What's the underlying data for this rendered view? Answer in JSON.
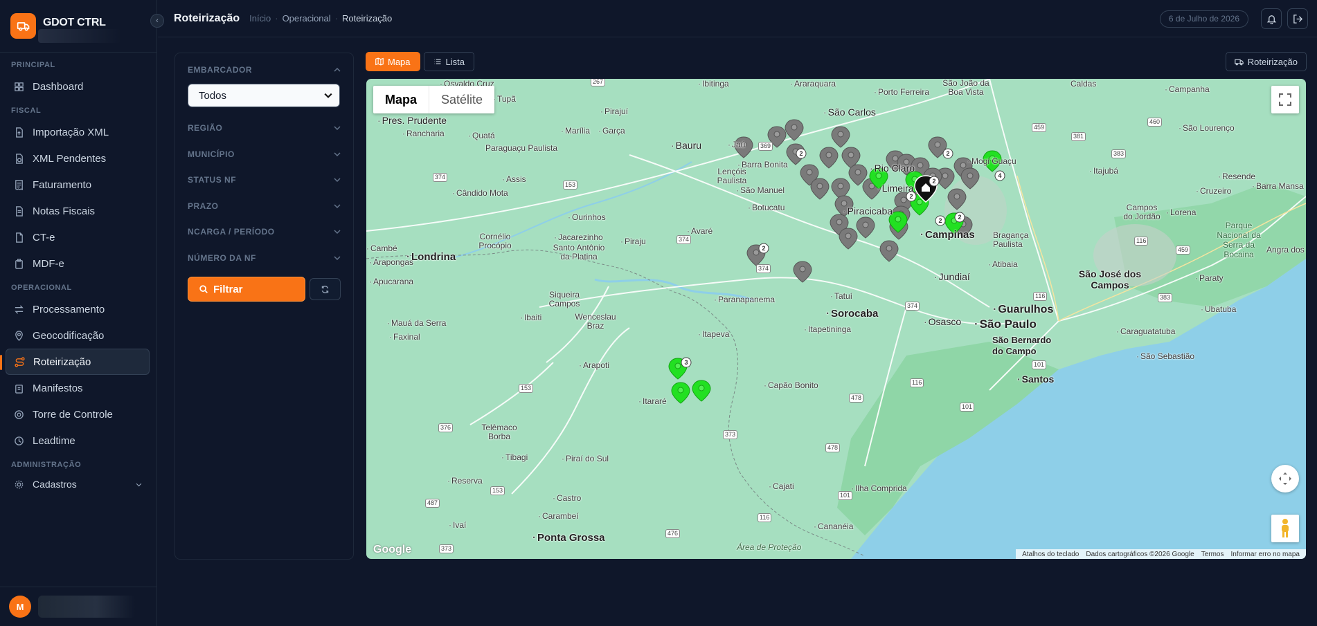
{
  "app": {
    "name": "GDOT CTRL"
  },
  "sidebar": {
    "sections": [
      {
        "label": "PRINCIPAL",
        "items": [
          {
            "label": "Dashboard"
          }
        ]
      },
      {
        "label": "FISCAL",
        "items": [
          {
            "label": "Importação XML"
          },
          {
            "label": "XML Pendentes"
          },
          {
            "label": "Faturamento"
          },
          {
            "label": "Notas Fiscais"
          },
          {
            "label": "CT-e"
          },
          {
            "label": "MDF-e"
          }
        ]
      },
      {
        "label": "OPERACIONAL",
        "items": [
          {
            "label": "Processamento"
          },
          {
            "label": "Geocodificação"
          },
          {
            "label": "Roteirização"
          },
          {
            "label": "Manifestos"
          },
          {
            "label": "Torre de Controle"
          },
          {
            "label": "Leadtime"
          }
        ]
      },
      {
        "label": "ADMINISTRAÇÃO",
        "items": [
          {
            "label": "Cadastros"
          }
        ]
      }
    ],
    "active_item": "Roteirização",
    "user_initial": "M"
  },
  "header": {
    "title": "Roteirização",
    "breadcrumb": [
      "Início",
      "Operacional",
      "Roteirização"
    ],
    "date": "6 de Julho de 2026"
  },
  "filters": {
    "embarcador_label": "EMBARCADOR",
    "embarcador_value": "Todos",
    "items": [
      "REGIÃO",
      "MUNICÍPIO",
      "STATUS NF",
      "PRAZO",
      "NCARGA / PERÍODO",
      "NÚMERO DA NF"
    ],
    "filter_button": "Filtrar"
  },
  "view_tabs": [
    "Mapa",
    "Lista"
  ],
  "active_view": "Mapa",
  "route_button": "Roteirização",
  "map": {
    "type_buttons": [
      "Mapa",
      "Satélite"
    ],
    "active_type": "Mapa",
    "logo": "Google",
    "attribution": [
      "Atalhos do teclado",
      "Dados cartográficos ©2026 Google",
      "Termos",
      "Informar erro no mapa"
    ],
    "cities": [
      "Osvaldo Cruz",
      "Tupã",
      "Pres. Prudente",
      "Rancharia",
      "Quatá",
      "Marília",
      "Garça",
      "Paraguaçu Paulista",
      "Assis",
      "Cândido Mota",
      "Bauru",
      "Jaú",
      "Barra Bonita",
      "Lençóis Paulista",
      "São Manuel",
      "Botucatu",
      "Ourinhos",
      "Avaré",
      "Piraju",
      "Jacarezinho",
      "Cornélio Procópio",
      "Santo Antônio da Platina",
      "Londrina",
      "Cambé",
      "Arapongas",
      "Apucarana",
      "Siqueira Campos",
      "Ibaiti",
      "Wenceslau Braz",
      "Itapeva",
      "Mauá da Serra",
      "Faxinal",
      "Arapoti",
      "Telêmaco Borba",
      "Tibagi",
      "Piraí do Sul",
      "Itararé",
      "Reserva",
      "Castro",
      "Carambeí",
      "Ponta Grossa",
      "Ivaí",
      "Capão Bonito",
      "Itapetininga",
      "Paranapanema",
      "Sorocaba",
      "Tatuí",
      "Osasco",
      "São Paulo",
      "Guarulhos",
      "São Bernardo do Campo",
      "Santos",
      "Campinas",
      "Jundiaí",
      "Atibaia",
      "Bragança Paulista",
      "São José dos Campos",
      "Caraguatatuba",
      "São Sebastião",
      "Ubatuba",
      "Paraty",
      "Lorena",
      "Cruzeiro",
      "Resende",
      "Campos do Jordão",
      "Itajubá",
      "São Lourenço",
      "Campanha",
      "Caldas",
      "São João da Boa Vista",
      "Mogi Guaçu",
      "Porto Ferreira",
      "São Carlos",
      "Araraquara",
      "Ibitinga",
      "Pirajuí",
      "Rio Claro",
      "Limeira",
      "Piracicaba",
      "Cajati",
      "Ilha Comprida",
      "Cananéia",
      "Área de Proteção",
      "Parque Nacional da Serra da Bocaina",
      "Angra dos",
      "Barra Mansa"
    ],
    "highways": [
      "267",
      "374",
      "153",
      "369",
      "374",
      "374",
      "153",
      "376",
      "153",
      "487",
      "373",
      "373",
      "476",
      "116",
      "478",
      "478",
      "101",
      "116",
      "374",
      "101",
      "101",
      "116",
      "459",
      "381",
      "383",
      "267",
      "460",
      "116",
      "459",
      "383"
    ],
    "cluster_counts": [
      "2",
      "2",
      "2",
      "2",
      "2",
      "2",
      "4",
      "2",
      "3"
    ]
  }
}
